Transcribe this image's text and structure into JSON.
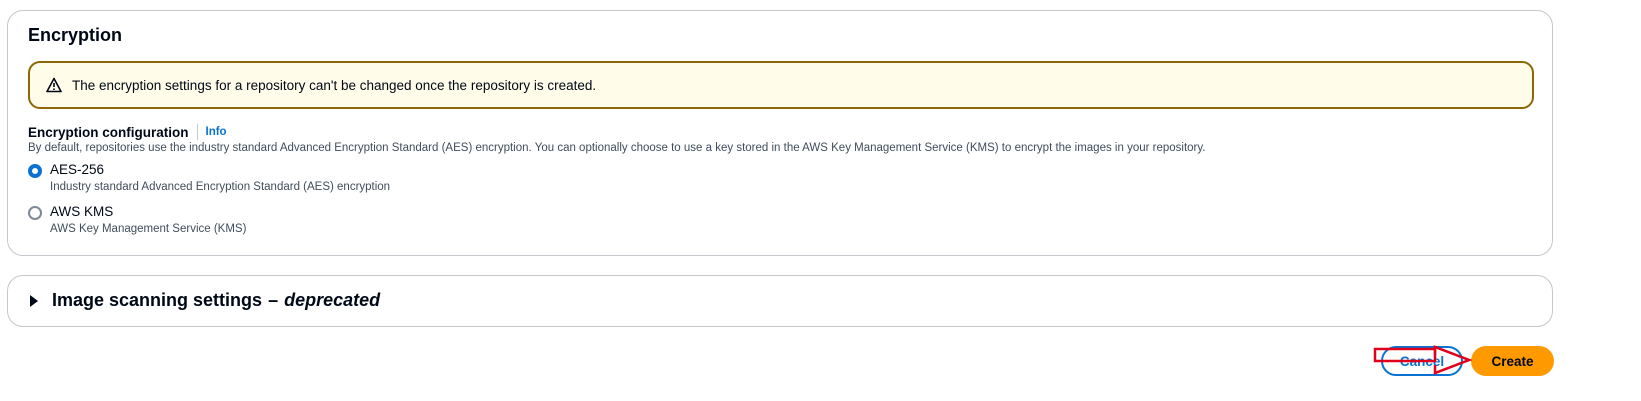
{
  "encryption": {
    "heading": "Encryption",
    "alert": {
      "icon": "warning-icon",
      "text": "The encryption settings for a repository can't be changed once the repository is created.",
      "border_color": "#8d6605",
      "background_color": "#fffce9"
    },
    "config_label": "Encryption configuration",
    "info_link": "Info",
    "description": "By default, repositories use the industry standard Advanced Encryption Standard (AES) encryption. You can optionally choose to use a key stored in the AWS Key Management Service (KMS) to encrypt the images in your repository.",
    "options": [
      {
        "label": "AES-256",
        "description": "Industry standard Advanced Encryption Standard (AES) encryption",
        "selected": true
      },
      {
        "label": "AWS KMS",
        "description": "AWS Key Management Service (KMS)",
        "selected": false
      }
    ]
  },
  "image_scanning": {
    "title": "Image scanning settings",
    "separator": "–",
    "suffix": "deprecated",
    "expanded": false
  },
  "actions": {
    "cancel_label": "Cancel",
    "create_label": "Create"
  },
  "colors": {
    "accent": "#0972d3",
    "primary_button": "#ff9900",
    "annotation": "#e0001b"
  }
}
